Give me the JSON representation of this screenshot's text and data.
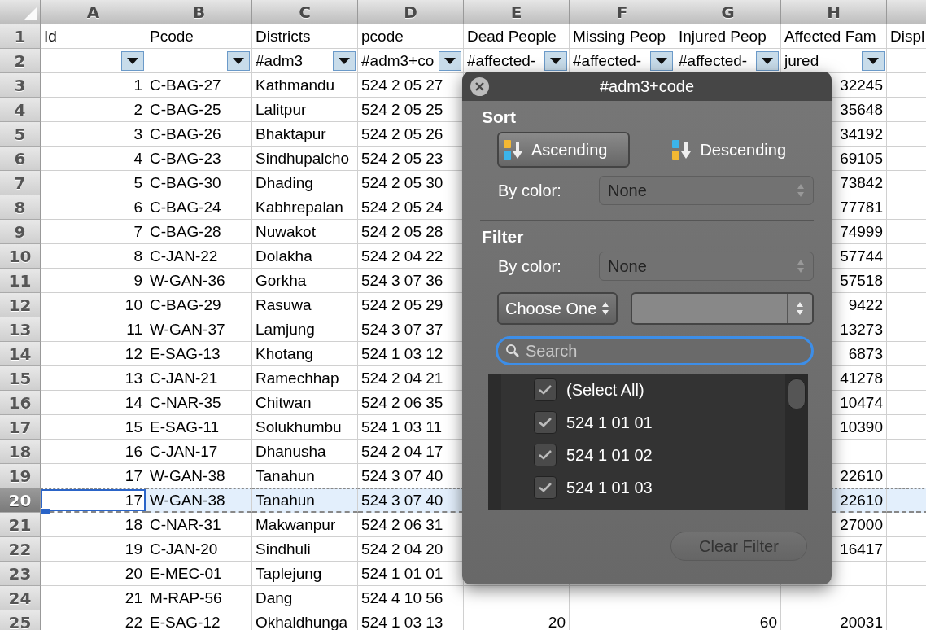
{
  "columns": [
    {
      "letter": "A"
    },
    {
      "letter": "B"
    },
    {
      "letter": "C"
    },
    {
      "letter": "D"
    },
    {
      "letter": "E"
    },
    {
      "letter": "F"
    },
    {
      "letter": "G"
    },
    {
      "letter": "H"
    },
    {}
  ],
  "rows": [
    {
      "number": "1",
      "kind": "header",
      "selected": false,
      "cells": {
        "A": "Id",
        "B": "Pcode",
        "C": "Districts",
        "D": "pcode",
        "E": "Dead People",
        "F": "Missing Peop",
        "G": "Injured Peop",
        "H": "Affected Fam",
        "I": "Displ"
      }
    },
    {
      "number": "2",
      "kind": "filter",
      "selected": false,
      "cells": {
        "C": "#adm3",
        "D": "#adm3+co",
        "E": "#affected-",
        "F": "#affected-",
        "G": "#affected-",
        "H": "jured"
      }
    },
    {
      "number": "3",
      "kind": "data",
      "selected": false,
      "cells": {
        "A": "1",
        "B": "C-BAG-27",
        "C": "Kathmandu",
        "D": "524 2 05 27",
        "H": "32245"
      }
    },
    {
      "number": "4",
      "kind": "data",
      "selected": false,
      "cells": {
        "A": "2",
        "B": "C-BAG-25",
        "C": "Lalitpur",
        "D": "524 2 05 25",
        "H": "35648"
      }
    },
    {
      "number": "5",
      "kind": "data",
      "selected": false,
      "cells": {
        "A": "3",
        "B": "C-BAG-26",
        "C": "Bhaktapur",
        "D": "524 2 05 26",
        "H": "34192"
      }
    },
    {
      "number": "6",
      "kind": "data",
      "selected": false,
      "cells": {
        "A": "4",
        "B": "C-BAG-23",
        "C": "Sindhupalcho",
        "D": "524 2 05 23",
        "H": "69105"
      }
    },
    {
      "number": "7",
      "kind": "data",
      "selected": false,
      "cells": {
        "A": "5",
        "B": "C-BAG-30",
        "C": "Dhading",
        "D": "524 2 05 30",
        "H": "73842"
      }
    },
    {
      "number": "8",
      "kind": "data",
      "selected": false,
      "cells": {
        "A": "6",
        "B": "C-BAG-24",
        "C": "Kabhrepalan",
        "D": "524 2 05 24",
        "H": "77781"
      }
    },
    {
      "number": "9",
      "kind": "data",
      "selected": false,
      "cells": {
        "A": "7",
        "B": "C-BAG-28",
        "C": "Nuwakot",
        "D": "524 2 05 28",
        "H": "74999"
      }
    },
    {
      "number": "10",
      "kind": "data",
      "selected": false,
      "cells": {
        "A": "8",
        "B": "C-JAN-22",
        "C": "Dolakha",
        "D": "524 2 04 22",
        "H": "57744"
      }
    },
    {
      "number": "11",
      "kind": "data",
      "selected": false,
      "cells": {
        "A": "9",
        "B": "W-GAN-36",
        "C": "Gorkha",
        "D": "524 3 07 36",
        "H": "57518"
      }
    },
    {
      "number": "12",
      "kind": "data",
      "selected": false,
      "cells": {
        "A": "10",
        "B": "C-BAG-29",
        "C": "Rasuwa",
        "D": "524 2 05 29",
        "H": "9422"
      }
    },
    {
      "number": "13",
      "kind": "data",
      "selected": false,
      "cells": {
        "A": "11",
        "B": "W-GAN-37",
        "C": "Lamjung",
        "D": "524 3 07 37",
        "H": "13273"
      }
    },
    {
      "number": "14",
      "kind": "data",
      "selected": false,
      "cells": {
        "A": "12",
        "B": "E-SAG-13",
        "C": "Khotang",
        "D": "524 1 03 12",
        "H": "6873"
      }
    },
    {
      "number": "15",
      "kind": "data",
      "selected": false,
      "cells": {
        "A": "13",
        "B": "C-JAN-21",
        "C": "Ramechhap",
        "D": "524 2 04 21",
        "H": "41278"
      }
    },
    {
      "number": "16",
      "kind": "data",
      "selected": false,
      "cells": {
        "A": "14",
        "B": "C-NAR-35",
        "C": "Chitwan",
        "D": "524 2 06 35",
        "H": "10474"
      }
    },
    {
      "number": "17",
      "kind": "data",
      "selected": false,
      "cells": {
        "A": "15",
        "B": "E-SAG-11",
        "C": "Solukhumbu",
        "D": "524 1 03 11",
        "H": "10390"
      }
    },
    {
      "number": "18",
      "kind": "data",
      "selected": false,
      "cells": {
        "A": "16",
        "B": "C-JAN-17",
        "C": "Dhanusha",
        "D": "524 2 04 17"
      }
    },
    {
      "number": "19",
      "kind": "data",
      "selected": false,
      "cells": {
        "A": "17",
        "B": "W-GAN-38",
        "C": "Tanahun",
        "D": "524 3 07 40",
        "H": "22610"
      }
    },
    {
      "number": "20",
      "kind": "data",
      "selected": true,
      "cells": {
        "A": "17",
        "B": "W-GAN-38",
        "C": "Tanahun",
        "D": "524 3 07 40",
        "H": "22610"
      }
    },
    {
      "number": "21",
      "kind": "data",
      "selected": false,
      "cells": {
        "A": "18",
        "B": "C-NAR-31",
        "C": "Makwanpur",
        "D": "524 2 06 31",
        "H": "27000"
      }
    },
    {
      "number": "22",
      "kind": "data",
      "selected": false,
      "cells": {
        "A": "19",
        "B": "C-JAN-20",
        "C": "Sindhuli",
        "D": "524 2 04 20",
        "H": "16417"
      }
    },
    {
      "number": "23",
      "kind": "data",
      "selected": false,
      "cells": {
        "A": "20",
        "B": "E-MEC-01",
        "C": "Taplejung",
        "D": "524 1 01 01"
      }
    },
    {
      "number": "24",
      "kind": "data",
      "selected": false,
      "cells": {
        "A": "21",
        "B": "M-RAP-56",
        "C": "Dang",
        "D": "524 4 10 56"
      }
    },
    {
      "number": "25",
      "kind": "data",
      "selected": false,
      "cells": {
        "A": "22",
        "B": "E-SAG-12",
        "C": "Okhaldhunga",
        "D": "524 1 03 13",
        "E": "20",
        "G": "60",
        "H": "20031"
      }
    }
  ],
  "filter_popup": {
    "title": "#adm3+code",
    "sort": {
      "heading": "Sort",
      "options": [
        {
          "label": "Ascending",
          "kind": "ascending",
          "selected": true
        },
        {
          "label": "Descending",
          "kind": "descending",
          "selected": false
        }
      ],
      "by_color_label": "By color:",
      "by_color_value": "None"
    },
    "filter": {
      "heading": "Filter",
      "by_color_label": "By color:",
      "by_color_value": "None",
      "condition": "Choose One",
      "search_placeholder": "Search",
      "items": [
        {
          "label": "(Select All)",
          "checked": true
        },
        {
          "label": "524 1 01 01",
          "checked": true
        },
        {
          "label": "524 1 01 02",
          "checked": true
        },
        {
          "label": "524 1 01 03",
          "checked": true
        }
      ]
    },
    "clear_button": {
      "label": "Clear Filter",
      "disabled": true
    }
  }
}
